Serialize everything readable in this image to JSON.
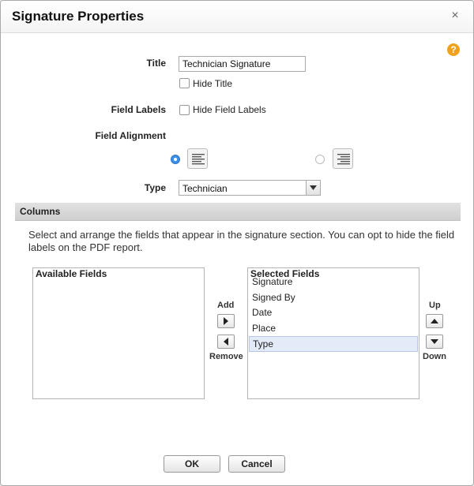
{
  "dialog": {
    "title": "Signature Properties",
    "close_glyph": "×",
    "help_glyph": "?"
  },
  "form": {
    "title_label": "Title",
    "title_value": "Technician Signature",
    "hide_title_label": "Hide Title",
    "hide_title_checked": false,
    "field_labels_label": "Field Labels",
    "hide_field_labels_label": "Hide Field Labels",
    "hide_field_labels_checked": false,
    "field_alignment_label": "Field Alignment",
    "alignment_selected": "left",
    "type_label": "Type",
    "type_value": "Technician"
  },
  "columns": {
    "section_label": "Columns",
    "description": "Select and arrange the fields that appear in the signature section. You can opt to hide the field labels on the PDF report.",
    "available_title": "Available Fields",
    "available_items": [],
    "selected_title": "Selected Fields",
    "selected_items": [
      "Signature",
      "Signed By",
      "Date",
      "Place",
      "Type"
    ],
    "selected_index": 4,
    "add_label": "Add",
    "remove_label": "Remove",
    "up_label": "Up",
    "down_label": "Down"
  },
  "footer": {
    "ok_label": "OK",
    "cancel_label": "Cancel"
  },
  "colors": {
    "accent": "#3d8fe8",
    "help": "#f0a21f",
    "selection": "#e3eaf8"
  },
  "icons": [
    "close-icon",
    "help-icon",
    "align-left-icon",
    "align-right-icon",
    "chevron-down-icon",
    "arrow-right-icon",
    "arrow-left-icon",
    "arrow-up-icon",
    "arrow-down-icon"
  ]
}
